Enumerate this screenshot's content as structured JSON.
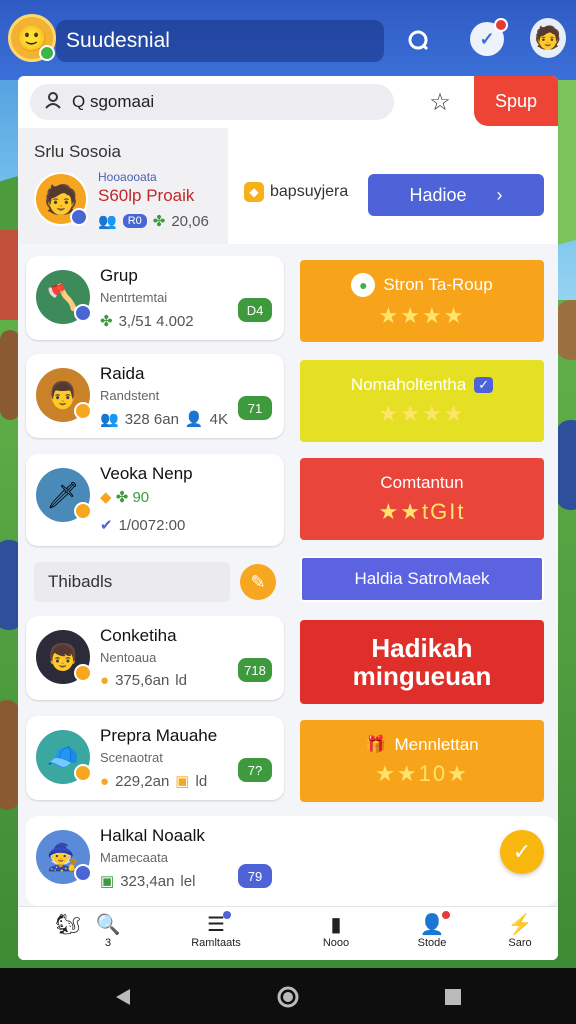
{
  "colors": {
    "topbar": "#3b6fd8",
    "primary": "#4f63d9",
    "danger": "#ee4436",
    "orange": "#f6a71f",
    "yellow": "#e6e024",
    "red": "#e9453a",
    "green": "#3d9a3d"
  },
  "topbar": {
    "title": "Suudesnial",
    "search_icon": "search-icon",
    "notification_icon": "chevron-badge-icon",
    "profile_icon": "avatar-icon"
  },
  "search": {
    "value": "Q sgomaai",
    "action_label": "Spup"
  },
  "feature": {
    "section_title": "Srlu Sosoia",
    "small_label": "Hooaooata",
    "name": "S60lp Proaik",
    "badge": "R0",
    "count": "20,06",
    "tag": "bapsuyjera",
    "button_label": "Hadioe",
    "button_arrow": "›"
  },
  "cards": [
    {
      "name": "Grup",
      "sub": "Nentrtemtai",
      "stats": "3,/51 4.002",
      "score": "D4"
    },
    {
      "name": "Raida",
      "sub": "Randstent",
      "stats": "328 6an",
      "extra": "4K",
      "score": "71"
    },
    {
      "name": "Veoka Nenp",
      "sub": "90",
      "stats": "1/0072:00",
      "score": ""
    },
    {
      "name": "Conketiha",
      "sub": "Nentoaua",
      "stats": "375,6an",
      "extra": "ld",
      "score": "718"
    },
    {
      "name": "Prepra Mauahe",
      "sub": "Scenaotrat",
      "stats": "229,2an",
      "extra": "ld",
      "score": "7?"
    },
    {
      "name": "Halkal Noaalk",
      "sub": "Mamecaata",
      "stats": "323,4an",
      "extra": "lel",
      "score": "79"
    }
  ],
  "filter": {
    "label": "Thibadls"
  },
  "actions": [
    {
      "label": "Stron Ta-Roup",
      "stars": "★★★★"
    },
    {
      "label": "Nomaholtentha",
      "stars": "★★★★"
    },
    {
      "label": "Comtantun",
      "stars": "★★tGIt"
    },
    {
      "label": "Haldia SatroMaek",
      "stars": ""
    },
    {
      "label": "Hadikah\nmingueuan",
      "stars": ""
    },
    {
      "label": "Mennlettan",
      "stars": "★★10★"
    }
  ],
  "tabs": [
    {
      "label": "",
      "icon": "mascot-icon"
    },
    {
      "label": "3",
      "icon": "search-icon"
    },
    {
      "label": "Ramltaats",
      "icon": "list-icon"
    },
    {
      "label": "Nooo",
      "icon": "book-icon"
    },
    {
      "label": "Stode",
      "icon": "user-icon"
    },
    {
      "label": "Saro",
      "icon": "bolt-icon"
    }
  ]
}
